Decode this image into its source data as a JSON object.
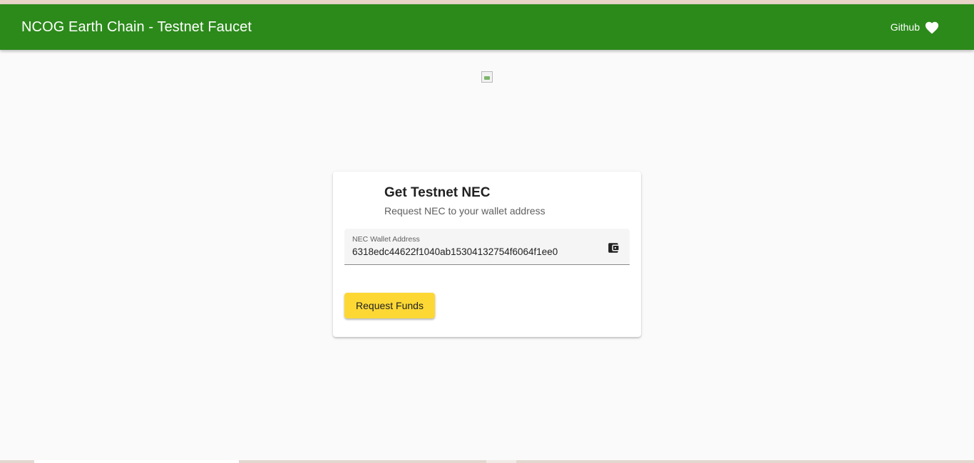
{
  "header": {
    "title": "NCOG Earth Chain - Testnet Faucet",
    "github_label": "Github",
    "github_icon": "heart-icon",
    "background_color": "#2c8a1b"
  },
  "logo": {
    "icon": "broken-image-icon"
  },
  "card": {
    "title": "Get Testnet NEC",
    "subtitle": "Request NEC to your wallet address",
    "address_field": {
      "label": "NEC Wallet Address",
      "value": "6318edc44622f1040ab15304132754f6064f1ee0",
      "icon": "wallet-icon"
    },
    "button_label": "Request Funds",
    "button_color": "#fdd835"
  }
}
